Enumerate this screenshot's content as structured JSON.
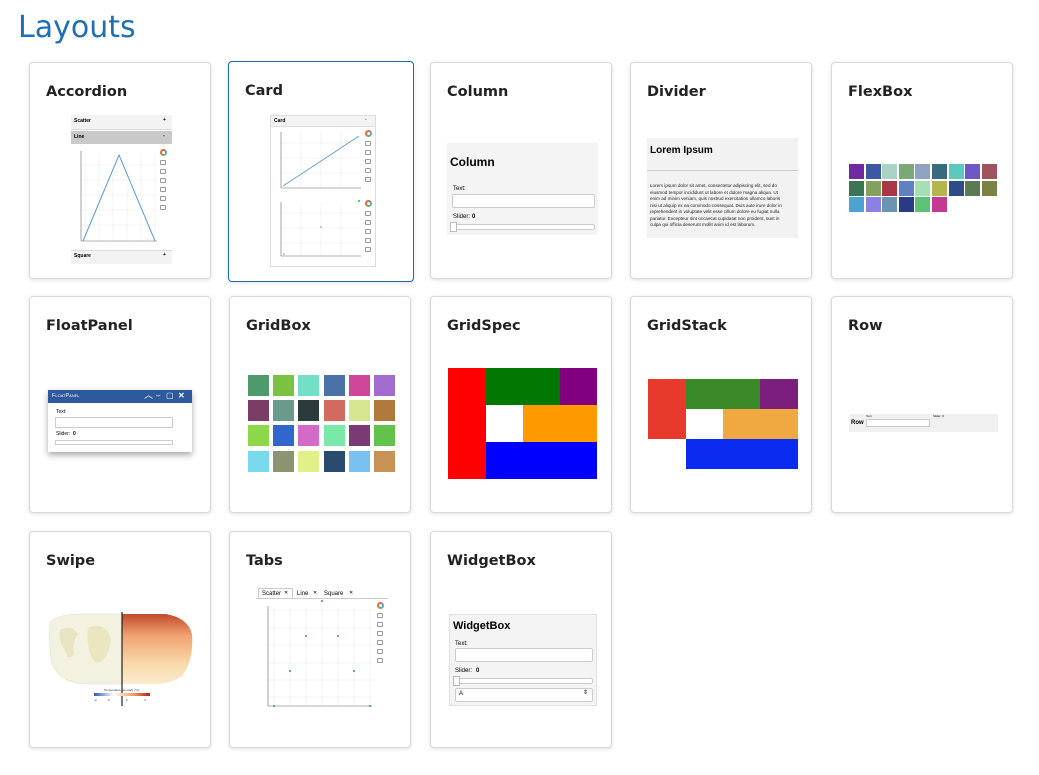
{
  "page": {
    "heading": "Layouts"
  },
  "cards": {
    "accordion": {
      "title": "Accordion",
      "sections": [
        "Scatter",
        "Line",
        "Square"
      ],
      "expanders": [
        "+",
        "-",
        "+"
      ],
      "yticks": [
        "4",
        "3.5",
        "3",
        "2.5",
        "2",
        "1.5",
        "1",
        "0.5",
        "0"
      ],
      "xticks": [
        "0",
        "1",
        "2",
        "3",
        "4",
        "5",
        "6"
      ]
    },
    "card": {
      "title": "Card",
      "panel_title": "Card",
      "collapse": "-",
      "yticks_top": [
        "3",
        "2.5",
        "2",
        "1.5",
        "1"
      ],
      "xticks_top": [
        "1",
        "2",
        "3",
        "4",
        "5"
      ],
      "yticks_bottom": [
        "4",
        "3",
        "2",
        "1"
      ],
      "xticks_bottom": [
        "0",
        "1",
        "2",
        "3",
        "4",
        "5"
      ]
    },
    "column": {
      "title": "Column",
      "panel_title": "Column",
      "text_label": "Text:",
      "slider_label": "Slider:",
      "slider_value": "0"
    },
    "divider": {
      "title": "Divider",
      "heading": "Lorem Ipsum",
      "lines": [
        "Lorem ipsum dolor sit amet, consectetur adipiscing elit, sed do",
        "eiusmod tempor incididunt ut labore et dolore magna aliqua. Ut",
        "enim ad minim veniam, quis nostrud exercitation ullamco laboris",
        "nisi ut aliquip ex ea commodo consequat. Duis aute irure dolor in",
        "reprehenderit in voluptate velit esse cillum dolore eu fugiat nulla",
        "pariatur. Excepteur sint occaecat cupidatat non proident, sunt in",
        "culpa qui officia deserunt mollit anim id est laborum."
      ]
    },
    "flexbox": {
      "title": "FlexBox",
      "colors": [
        "#6f2aa3",
        "#3c58a0",
        "#a8d3c5",
        "#7ba878",
        "#8fa3c1",
        "#3a6a7e",
        "#5bc9be",
        "#6e58c7",
        "#a0525e",
        "#3a7656",
        "#84a05e",
        "#a83645",
        "#5d82bf",
        "#a6e0b2",
        "#b3b54d",
        "#2b4c86",
        "#5a7a55",
        "#7b8245",
        "#4aa3d1",
        "#8c80e3",
        "#6b94b0",
        "#2a3b86",
        "#5ec276",
        "#c53993"
      ]
    },
    "floatpanel": {
      "title": "FloatPanel",
      "panel_title": "FloatPanel",
      "controls": [
        "︿",
        "–",
        "▢",
        "✕"
      ],
      "text_label": "Text:",
      "slider_label": "Slider:",
      "slider_value": "0"
    },
    "gridbox": {
      "title": "GridBox",
      "colors": [
        "#4e9a6a",
        "#7ac240",
        "#73e0c6",
        "#4a72a6",
        "#d0469b",
        "#a36dd0",
        "#7a3e66",
        "#6a9a8c",
        "#2b3a3a",
        "#d26a60",
        "#d6e68f",
        "#b07a3c",
        "#8ed64a",
        "#3166cc",
        "#d46ac8",
        "#7ae8a6",
        "#7a3b74",
        "#63c24b",
        "#7ad8ec",
        "#8a9470",
        "#e2f08a",
        "#2a4a70",
        "#7ac0f0",
        "#c79256"
      ]
    },
    "gridspec": {
      "title": "GridSpec"
    },
    "gridstack": {
      "title": "GridStack"
    },
    "row": {
      "title": "Row",
      "row_label": "Row",
      "text_label": "Text:",
      "slider_label": "Slider: 0"
    },
    "swipe": {
      "title": "Swipe",
      "legend_label": "Temperature Anomaly (°C)",
      "legend_ticks": [
        "-2",
        "0",
        "2",
        "4"
      ]
    },
    "tabs": {
      "title": "Tabs",
      "tabs": [
        "Scatter",
        "Line",
        "Square"
      ],
      "close": "✕",
      "yticks": [
        "3",
        "2.5",
        "2",
        "1.5",
        "1",
        "0.5",
        "0"
      ],
      "xticks": [
        "0",
        "1",
        "2",
        "3",
        "4",
        "5",
        "6"
      ]
    },
    "widgetbox": {
      "title": "WidgetBox",
      "panel_title": "WidgetBox",
      "text_label": "Text:",
      "slider_label": "Slider:",
      "slider_value": "0",
      "select_value": "A",
      "select_arrow": "⇕"
    }
  },
  "colors": {
    "heading": "#1f6fb5",
    "selected_border": "#1b6bb0",
    "gridspec": {
      "red": "#ff0000",
      "green": "#007800",
      "purple": "#800080",
      "orange": "#ff9900",
      "blue": "#0000ff"
    },
    "gridstack": {
      "red": "#e83a2c",
      "green": "#3a8a2a",
      "purple": "#7a1f7c",
      "orange": "#f0a841",
      "blue": "#0a2cf0"
    }
  }
}
